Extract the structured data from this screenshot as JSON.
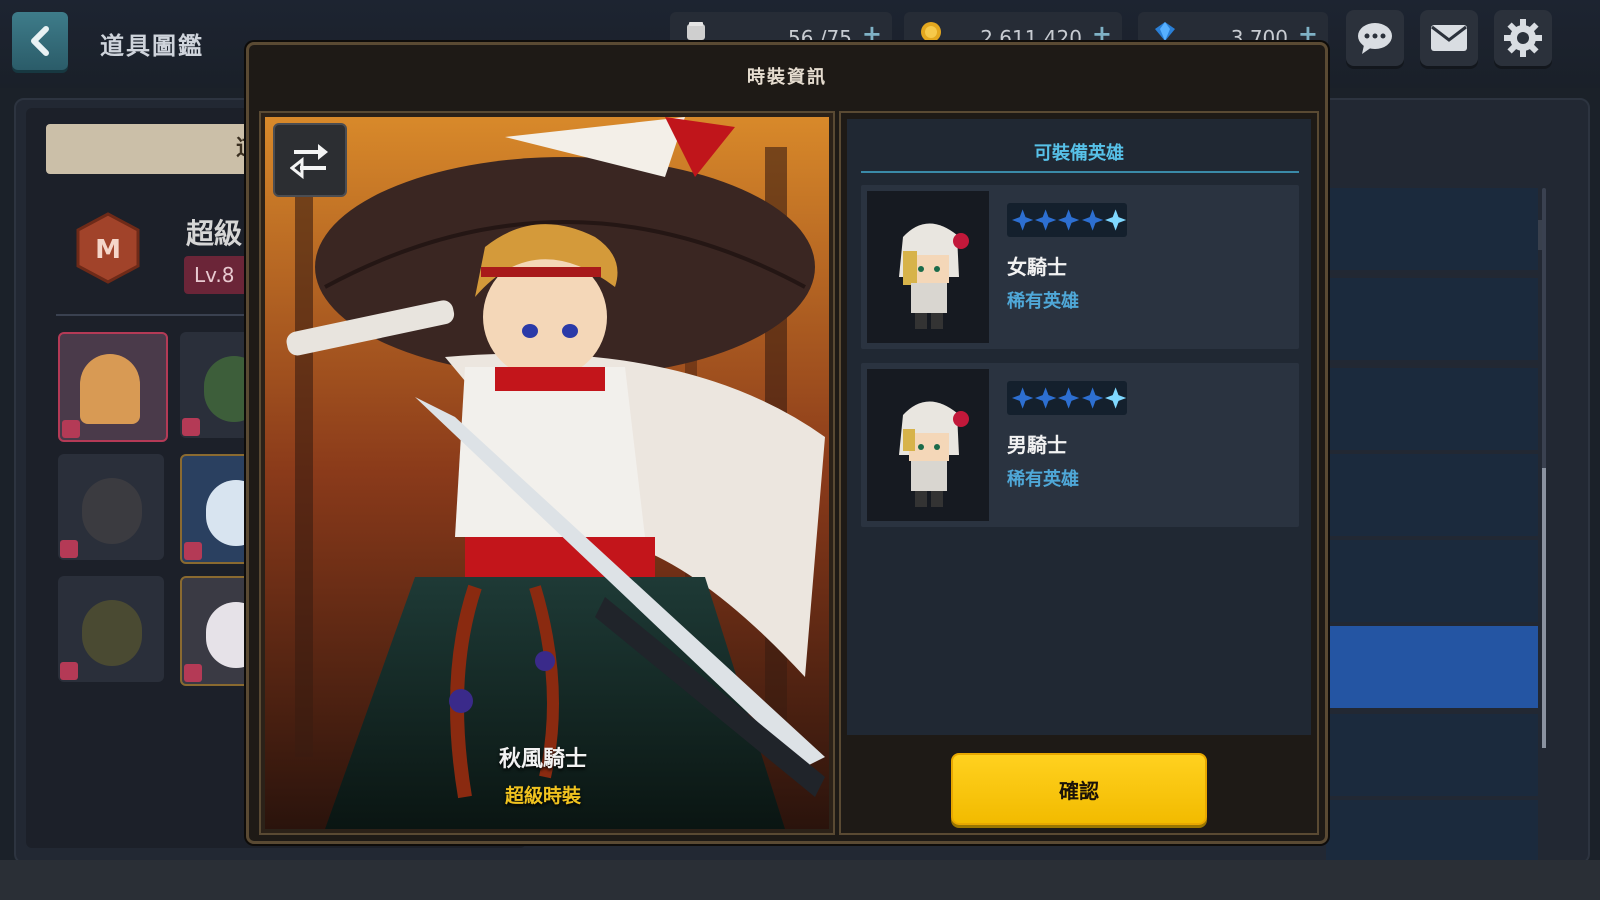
{
  "header": {
    "back_icon": "chevron-left-icon",
    "title": "道具圖鑑",
    "stamina": "56 /75",
    "gold": "2,611,420",
    "gems": "3,700",
    "icons": [
      "chat-icon",
      "mail-icon",
      "gear-icon"
    ]
  },
  "background_panel": {
    "tab_label": "道",
    "collection_name": "超級",
    "level": "Lv.8",
    "help_label": "?",
    "scroll_fraction": 0.5
  },
  "modal": {
    "title": "時裝資訊",
    "costume_name": "秋風騎士",
    "costume_grade": "超級時裝",
    "swap_icon": "swap-arrows-icon",
    "heroes_title": "可裝備英雄",
    "heroes": [
      {
        "name": "女騎士",
        "rarity": "稀有英雄",
        "stars": 5
      },
      {
        "name": "男騎士",
        "rarity": "稀有英雄",
        "stars": 5
      }
    ],
    "confirm_label": "確認"
  },
  "colors": {
    "accent_yellow": "#F5C211",
    "rarity_blue": "#4FA8D8",
    "heroes_title_cyan": "#57C1E8",
    "modal_border": "#5A4A33"
  }
}
